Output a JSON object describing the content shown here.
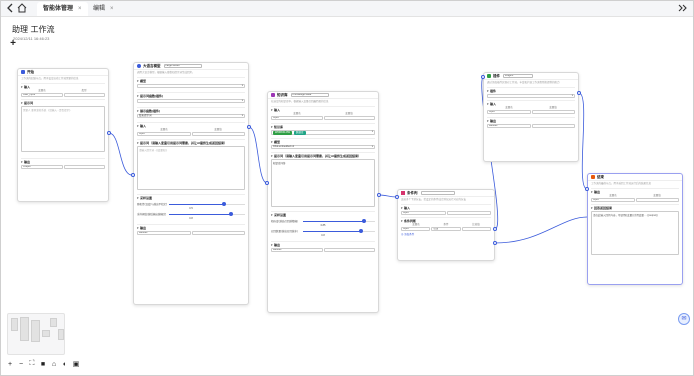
{
  "header": {
    "back_icon": "chevron-left",
    "home_icon": "home",
    "tabs": [
      {
        "label": "智能体管理",
        "active": true
      },
      {
        "label": "编辑",
        "active": false
      }
    ],
    "close_glyph": "×",
    "collapse_icon": "double-chevron-right"
  },
  "workflow": {
    "title": "助理 工作流",
    "timestamp": "2024/12/11 16:46:23",
    "add_glyph": "+"
  },
  "nodes": {
    "start": {
      "title": "开始",
      "desc": "工作流的起始节点，用于设定启动工作流需要的信息",
      "input_section": "输入",
      "col_name": "变量名",
      "col_type": "类型",
      "input_value": "User_input",
      "prompt_section": "提示词",
      "prompt_placeholder": "需要人 要开发的系统 《请输入 - 是否提示》",
      "output_section": "输出",
      "output_value": "Output"
    },
    "llm": {
      "title": "大语言模型",
      "name_value": "Large Model",
      "desc": "调用大语言模型，根据输入参数和提示词生成回复。",
      "model_section": "模型",
      "model_value": "",
      "prompt_template_section": "提示词函数(插件)",
      "prompt_template_value": "",
      "show_return_section": "展示函数(插件)",
      "show_return_value": "暂无提示词",
      "input_section": "输入",
      "col_name": "变量名",
      "col_value": "变量值",
      "input_value": "Input",
      "prompt_section": "提示词（请输入变量引用提示词需要，并让AI最终生成返回结果）",
      "prompt_value": "请输入提示词 - {{变量名}}",
      "params_section": "采样设置",
      "param1_label": "随机性(温度)与越高不稳定性",
      "param1_value": "0.5",
      "param1_fraction": 0.72,
      "param2_label": "采样阈值(越低输出越确定)",
      "param2_value": "0.8",
      "param2_fraction": 0.82,
      "output_section": "输出",
      "output_value": "Results"
    },
    "knowledge": {
      "title": "知识库",
      "name_value": "Knowledge Base",
      "desc": "在选定的知识库中，根据输入变量召回最匹配的信息",
      "input_section": "输入",
      "col_name": "变量名",
      "col_value": "变量值",
      "input_value": "Input",
      "kb_section": "知识库",
      "kb_tags": [
        "WORKFLOW",
        "数据库"
      ],
      "model_section": "模型",
      "model_value": "Chat.embedded.v1",
      "prompt_section": "提示词（请输入变量引用提示词需要，并让AI最终生成返回结果）",
      "prompt_value": "知识库问答",
      "params_section": "采样设置",
      "param1_label": "相似度(越高召回越精确)",
      "param1_value": "0.85",
      "param1_fraction": 0.85,
      "param2_label": "召回数量(越高召回越多)",
      "param2_value": "0.8",
      "param2_fraction": 0.8,
      "output_section": "输出",
      "output_value": "Results"
    },
    "condition": {
      "title": "条件判",
      "desc": "连接多个下游分支，若设定的条件成立则仅运行对应的分支",
      "input_section": "输入",
      "input_value": "Input",
      "cond_section": "条件判断",
      "col_name": "变量名",
      "col_cond": "条件",
      "col_value": "比较值",
      "cond_var": "Input",
      "cond_op": "包含",
      "cond_val": "",
      "add_cond_label": "添加条件"
    },
    "plugin": {
      "title": "插件",
      "name_value": "Plugins",
      "desc": "通过添加插件实现对工作流，丰富和扩展工作流程所能提供的能力",
      "plugin_section": "插件",
      "plugin_value": "",
      "input_section": "输入",
      "col_name": "变量名",
      "col_value": "变量值",
      "input_value": "Input",
      "output_section": "输出",
      "output_value": "Results"
    },
    "end": {
      "title": "结束",
      "desc": "工作流的最终节点，用于返回工作流运行后的结果信息",
      "output_section": "输出",
      "col_name": "变量名",
      "col_value": "变量值",
      "output_var": "Input",
      "output_val": "",
      "reply_section": "回答返回结果",
      "reply_value": "请在此输入回复内容，可使用{{变量}}引用变量 ... {{output}}"
    }
  },
  "zoom_controls": [
    "+",
    "−",
    "⛶",
    "■",
    "⌂",
    "◐",
    "▣"
  ],
  "colors": {
    "accent": "#3b5bdb",
    "kb_tag_1": "#2f9e44",
    "kb_tag_2": "#20a486",
    "start_icon": "#3b5bdb",
    "llm_icon": "#3b5bdb",
    "kb_icon": "#9c36b5",
    "condition_icon": "#d6336c",
    "plugin_icon": "#2f9e44",
    "end_icon": "#e8590c"
  }
}
